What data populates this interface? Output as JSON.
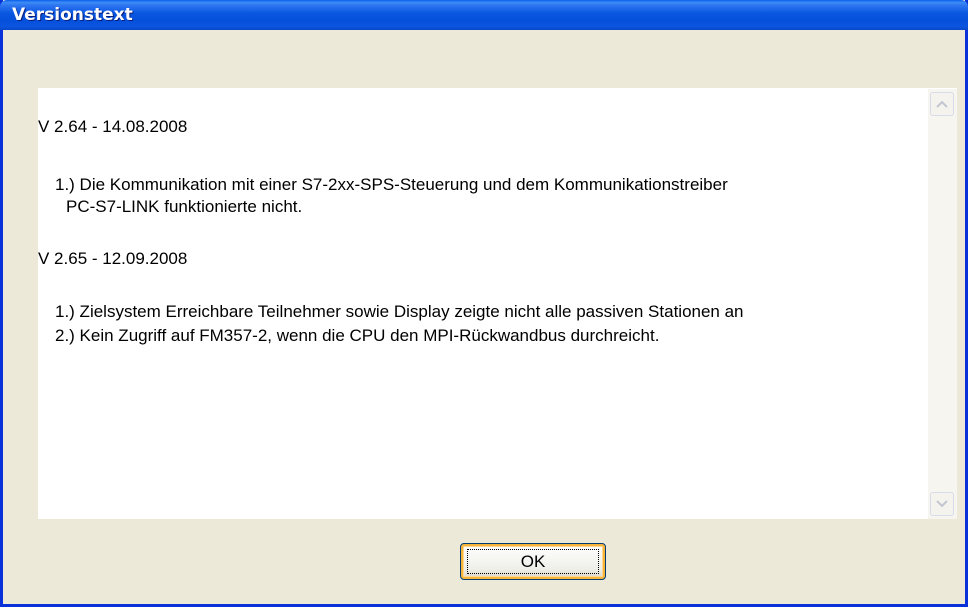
{
  "window": {
    "title": "Versionstext"
  },
  "version_text": {
    "lines": [
      "V 2.64 - 14.08.2008",
      "1.) Die Kommunikation mit einer S7-2xx-SPS-Steuerung und dem Kommunikationstreiber",
      "PC-S7-LINK funktionierte nicht.",
      "V 2.65 - 12.09.2008",
      "1.) Zielsystem Erreichbare Teilnehmer sowie Display zeigte nicht alle passiven Stationen an",
      "2.) Kein Zugriff auf FM357-2, wenn die CPU den MPI-Rückwandbus durchreicht."
    ]
  },
  "buttons": {
    "ok_label": "OK"
  },
  "icons": {
    "scroll_up": "chevron-up-icon",
    "scroll_down": "chevron-down-icon"
  },
  "colors": {
    "titlebar": "#0856E0",
    "window_face": "#ECE9D8",
    "text_area": "#FFFFFF"
  }
}
